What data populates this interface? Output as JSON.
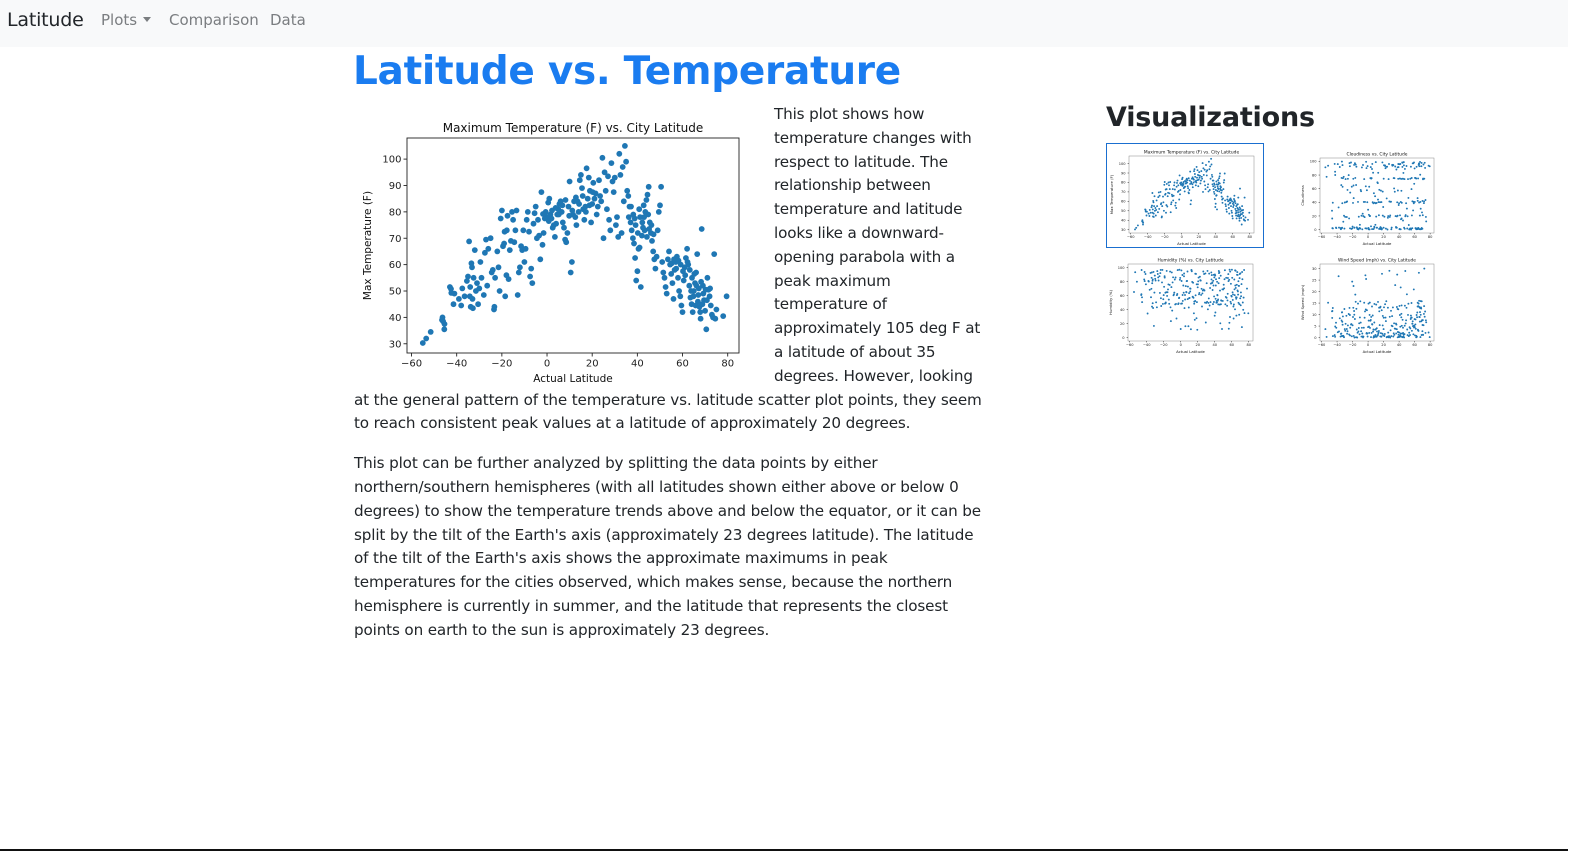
{
  "navbar": {
    "brand": "Latitude",
    "links": [
      {
        "label": "Plots",
        "dropdown": true
      },
      {
        "label": "Comparison"
      },
      {
        "label": "Data"
      }
    ]
  },
  "main": {
    "title": "Latitude vs. Temperature",
    "paragraphs": [
      "This plot shows how temperature changes with respect to latitude. The relationship between temperature and latitude looks like a downward-opening parabola with a peak maximum temperature of approximately 105 deg F at a latitude of about 35 degrees. However, looking at the general pattern of the temperature vs. latitude scatter plot points, they seem to reach consistent peak values at a latitude of approximately 20 degrees.",
      "This plot can be further analyzed by splitting the data points by either northern/southern hemispheres (with all latitudes shown either above or below 0 degrees) to show the temperature trends above and below the equator, or it can be split by the tilt of the Earth's axis (approximately 23 degrees latitude). The latitude of the tilt of the Earth's axis shows the approximate maximums in peak temperatures for the cities observed, which makes sense, because the northern hemisphere is currently in summer, and the latitude that represents the closest points on earth to the sun is approximately 23 degrees."
    ]
  },
  "sidebar": {
    "title": "Visualizations",
    "thumbnails": [
      {
        "title": "Maximum Temperature (F) vs. City Latitude",
        "selected": true
      },
      {
        "title": "Cloudiness vs. City Latitude",
        "selected": false
      },
      {
        "title": "Humidity (%) vs. City Latitude",
        "selected": false
      },
      {
        "title": "Wind Speed (mph) vs. City Latitude",
        "selected": false
      }
    ]
  },
  "colors": {
    "accent": "#1a7cf0",
    "marker": "#1f77b4",
    "navbar_bg": "#f8f9fa",
    "thumb_selected_border": "#1a6fd0"
  },
  "chart_data": [
    {
      "type": "scatter",
      "title": "Maximum Temperature (F) vs. City Latitude",
      "xlabel": "Actual Latitude",
      "ylabel": "Max Temperature (F)",
      "xlim": [
        -62,
        85
      ],
      "ylim": [
        26.5,
        108
      ],
      "xticks": [
        -60,
        -40,
        -20,
        0,
        20,
        40,
        60,
        80
      ],
      "yticks": [
        30,
        40,
        50,
        60,
        70,
        80,
        90,
        100
      ],
      "grid": false,
      "legend": "none",
      "points": [
        [
          -55,
          30.3
        ],
        [
          -53.5,
          32
        ],
        [
          -51.5,
          34.5
        ],
        [
          -46.5,
          39
        ],
        [
          -46.3,
          40
        ],
        [
          -46,
          38.5
        ],
        [
          -45.5,
          35.5
        ],
        [
          -45.4,
          37.5
        ],
        [
          -43,
          51.5
        ],
        [
          -42.5,
          50.8
        ],
        [
          -42.4,
          49.3
        ],
        [
          -41.4,
          45
        ],
        [
          -41,
          49
        ],
        [
          -39,
          47
        ],
        [
          -38,
          44.5
        ],
        [
          -37.5,
          51
        ],
        [
          -36.5,
          48
        ],
        [
          -35.5,
          53.8
        ],
        [
          -35,
          55.5
        ],
        [
          -34.5,
          68.8
        ],
        [
          -34.2,
          48
        ],
        [
          -34,
          51.5
        ],
        [
          -33.8,
          44
        ],
        [
          -33.5,
          60.5
        ],
        [
          -33.2,
          59
        ],
        [
          -33,
          47
        ],
        [
          -32.8,
          43.5
        ],
        [
          -32.5,
          55
        ],
        [
          -32,
          65.5
        ],
        [
          -31.5,
          50
        ],
        [
          -31,
          53
        ],
        [
          -30.5,
          45
        ],
        [
          -30,
          51
        ],
        [
          -29.5,
          61
        ],
        [
          -29,
          55
        ],
        [
          -28,
          48.5
        ],
        [
          -27.5,
          64.5
        ],
        [
          -27,
          69.5
        ],
        [
          -26.5,
          52
        ],
        [
          -26,
          66
        ],
        [
          -25,
          70
        ],
        [
          -24.5,
          57
        ],
        [
          -24,
          58
        ],
        [
          -23.5,
          43
        ],
        [
          -23.3,
          44
        ],
        [
          -23,
          55
        ],
        [
          -22,
          65
        ],
        [
          -21.5,
          59
        ],
        [
          -21,
          50
        ],
        [
          -20.5,
          77.5
        ],
        [
          -20,
          80.5
        ],
        [
          -19.5,
          67
        ],
        [
          -19,
          68
        ],
        [
          -18.8,
          72.5
        ],
        [
          -18.5,
          48
        ],
        [
          -18,
          56
        ],
        [
          -17.8,
          73
        ],
        [
          -17.5,
          78.5
        ],
        [
          -17,
          54.5
        ],
        [
          -16.5,
          65.5
        ],
        [
          -16,
          69
        ],
        [
          -15.5,
          80
        ],
        [
          -15,
          77
        ],
        [
          -14.5,
          68.5
        ],
        [
          -14,
          73
        ],
        [
          -13.5,
          80.5
        ],
        [
          -13,
          48.5
        ],
        [
          -12.5,
          57
        ],
        [
          -12,
          59
        ],
        [
          -11.5,
          67
        ],
        [
          -11,
          65.5
        ],
        [
          -10.5,
          73
        ],
        [
          -10,
          61
        ],
        [
          -9.5,
          66
        ],
        [
          -9,
          77
        ],
        [
          -8.5,
          80
        ],
        [
          -8,
          72.5
        ],
        [
          -7.5,
          55.5
        ],
        [
          -7,
          58.5
        ],
        [
          -6.5,
          53
        ],
        [
          -6,
          75.5
        ],
        [
          -5.5,
          79.5
        ],
        [
          -5,
          82
        ],
        [
          -4.5,
          70
        ],
        [
          -4,
          77
        ],
        [
          -3.5,
          71
        ],
        [
          -3,
          62
        ],
        [
          -2.5,
          87.5
        ],
        [
          -2,
          67.5
        ],
        [
          -1.5,
          72
        ],
        [
          -1,
          77.5
        ],
        [
          0,
          78
        ],
        [
          0.5,
          83.5
        ],
        [
          1,
          85
        ],
        [
          1.5,
          79
        ],
        [
          2,
          77.5
        ],
        [
          2.5,
          74
        ],
        [
          3,
          75
        ],
        [
          3.5,
          70.5
        ],
        [
          4,
          75.5
        ],
        [
          4.5,
          79
        ],
        [
          5,
          81
        ],
        [
          5.5,
          83
        ],
        [
          6,
          84
        ],
        [
          6.5,
          80
        ],
        [
          7,
          76
        ],
        [
          7.5,
          74
        ],
        [
          8,
          69.5
        ],
        [
          8.5,
          68.5
        ],
        [
          9,
          72
        ],
        [
          9.5,
          82
        ],
        [
          10,
          91.5
        ],
        [
          10.5,
          57
        ],
        [
          11,
          61
        ],
        [
          11.5,
          79
        ],
        [
          12,
          84
        ],
        [
          12.5,
          78
        ],
        [
          13,
          75
        ],
        [
          13.5,
          84
        ],
        [
          14,
          80
        ],
        [
          14.5,
          92
        ],
        [
          15,
          94
        ],
        [
          15.5,
          89
        ],
        [
          16,
          81
        ],
        [
          16.5,
          77
        ],
        [
          17,
          82
        ],
        [
          17.5,
          96.5
        ],
        [
          18,
          85
        ],
        [
          18.5,
          93
        ],
        [
          19,
          88
        ],
        [
          19.5,
          76
        ],
        [
          20,
          83
        ],
        [
          20.5,
          91
        ],
        [
          21,
          85
        ],
        [
          21.5,
          87
        ],
        [
          22,
          79
        ],
        [
          22.5,
          82
        ],
        [
          23,
          92
        ],
        [
          23.5,
          86
        ],
        [
          24,
          84
        ],
        [
          24.5,
          100.5
        ],
        [
          25,
          70
        ],
        [
          25.5,
          95
        ],
        [
          26,
          88
        ],
        [
          26.5,
          81
        ],
        [
          27,
          93.5
        ],
        [
          27.5,
          77
        ],
        [
          28,
          73
        ],
        [
          28.5,
          98.5
        ],
        [
          29,
          91.5
        ],
        [
          29.5,
          87.5
        ],
        [
          30,
          93
        ],
        [
          30.5,
          75
        ],
        [
          31,
          78
        ],
        [
          31.5,
          70.5
        ],
        [
          32,
          102
        ],
        [
          32.5,
          94
        ],
        [
          33,
          72
        ],
        [
          33.5,
          97
        ],
        [
          34,
          84
        ],
        [
          34.5,
          105
        ],
        [
          35,
          99
        ],
        [
          35.5,
          88
        ],
        [
          36,
          86
        ],
        [
          36.5,
          82
        ],
        [
          37,
          76
        ],
        [
          37.5,
          73
        ],
        [
          38,
          70
        ],
        [
          38.5,
          68
        ],
        [
          39,
          62.5
        ],
        [
          39.5,
          54
        ],
        [
          40,
          57.5
        ],
        [
          40.5,
          66
        ],
        [
          41,
          66.5
        ],
        [
          41.5,
          51.5
        ],
        [
          42,
          71
        ],
        [
          42.5,
          74
        ],
        [
          43,
          78
        ],
        [
          43.5,
          80
        ],
        [
          44,
          84.5
        ],
        [
          44.5,
          86.5
        ],
        [
          45,
          89.5
        ],
        [
          45.5,
          76
        ],
        [
          46,
          72
        ],
        [
          46.5,
          69
        ],
        [
          47,
          65
        ],
        [
          47.5,
          62
        ],
        [
          48,
          58.5
        ],
        [
          48.5,
          63
        ],
        [
          49,
          73
        ],
        [
          49.5,
          80
        ],
        [
          50,
          82.5
        ],
        [
          50.5,
          89.5
        ],
        [
          51,
          61
        ],
        [
          51.5,
          57
        ],
        [
          52,
          55
        ],
        [
          52.5,
          51.5
        ],
        [
          53,
          49
        ],
        [
          53.5,
          62
        ],
        [
          54,
          65
        ],
        [
          54.5,
          60
        ],
        [
          55,
          56.5
        ],
        [
          55.5,
          53
        ],
        [
          56,
          47
        ],
        [
          56.5,
          58
        ],
        [
          57,
          61
        ],
        [
          57.5,
          63
        ],
        [
          58,
          55
        ],
        [
          58.5,
          50
        ],
        [
          59,
          48
        ],
        [
          59.5,
          44.5
        ],
        [
          60,
          42
        ],
        [
          60.5,
          54
        ],
        [
          61,
          59
        ],
        [
          61.5,
          62.5
        ],
        [
          62,
          66
        ],
        [
          62.5,
          60
        ],
        [
          63,
          52
        ],
        [
          63.5,
          47.5
        ],
        [
          64,
          45
        ],
        [
          64.5,
          42
        ],
        [
          65,
          50
        ],
        [
          65.5,
          53
        ],
        [
          66,
          57
        ],
        [
          66.5,
          64
        ],
        [
          67,
          48.5
        ],
        [
          67.5,
          44
        ],
        [
          68,
          39.5
        ],
        [
          68.5,
          73.5
        ],
        [
          69,
          52
        ],
        [
          69.5,
          46.5
        ],
        [
          70,
          42.5
        ],
        [
          70.5,
          35.5
        ],
        [
          71,
          55
        ],
        [
          71.5,
          50.5
        ],
        [
          72,
          48
        ],
        [
          72.5,
          44.5
        ],
        [
          73,
          41
        ],
        [
          73.5,
          40
        ],
        [
          74,
          64
        ],
        [
          74.5,
          39.5
        ],
        [
          75,
          43
        ],
        [
          78,
          40.5
        ],
        [
          79.5,
          48
        ],
        [
          -1.8,
          79.2
        ],
        [
          -0.6,
          80
        ],
        [
          0.8,
          76.5
        ],
        [
          2.2,
          80.5
        ],
        [
          3.8,
          81.5
        ],
        [
          5.2,
          79
        ],
        [
          6.8,
          82.5
        ],
        [
          8.2,
          84.5
        ],
        [
          9.8,
          78.5
        ],
        [
          11.2,
          80.5
        ],
        [
          12.8,
          85.5
        ],
        [
          14.2,
          83
        ],
        [
          15.8,
          86
        ],
        [
          17.2,
          80
        ],
        [
          18.8,
          82.5
        ],
        [
          20.2,
          87.5
        ],
        [
          36.2,
          78
        ],
        [
          37.2,
          82
        ],
        [
          38.2,
          79
        ],
        [
          39.2,
          75
        ],
        [
          40.2,
          72
        ],
        [
          41.2,
          78
        ],
        [
          42.2,
          76
        ],
        [
          43.2,
          73
        ],
        [
          44.2,
          70.5
        ],
        [
          45.2,
          73.5
        ],
        [
          46.2,
          75
        ],
        [
          47.2,
          71.5
        ],
        [
          38.8,
          77.5
        ],
        [
          40.8,
          81
        ],
        [
          42.8,
          82.5
        ],
        [
          44.8,
          79
        ],
        [
          55.2,
          60.5
        ],
        [
          56.2,
          62
        ],
        [
          57.2,
          58.5
        ],
        [
          58.2,
          61.5
        ],
        [
          59.2,
          60
        ],
        [
          60.2,
          57.5
        ],
        [
          61.2,
          56
        ],
        [
          62.2,
          61
        ],
        [
          63.2,
          58
        ],
        [
          64.2,
          55
        ],
        [
          65.2,
          56.5
        ],
        [
          66.2,
          52
        ],
        [
          67.2,
          51
        ],
        [
          68.2,
          53.5
        ],
        [
          69.2,
          49
        ],
        [
          70.2,
          50.5
        ],
        [
          64.8,
          48
        ],
        [
          66.8,
          46
        ],
        [
          68.8,
          45
        ],
        [
          70.8,
          46.5
        ],
        [
          72.2,
          51
        ],
        [
          63.8,
          50
        ],
        [
          65.8,
          44.5
        ],
        [
          67.8,
          42
        ]
      ]
    },
    {
      "type": "scatter",
      "title": "Maximum Temperature (F) vs. City Latitude",
      "xlabel": "Actual Latitude",
      "ylabel": "Max Temperature (F)",
      "xlim": [
        -62,
        85
      ],
      "ylim": [
        26.5,
        108
      ],
      "xticks": [
        -60,
        -40,
        -20,
        0,
        20,
        40,
        60,
        80
      ],
      "yticks": [
        30,
        40,
        50,
        60,
        70,
        80,
        90,
        100
      ],
      "reuse_points_of": 0
    },
    {
      "type": "scatter",
      "title": "Cloudiness vs. City Latitude",
      "xlabel": "Actual Latitude",
      "ylabel": "Cloudiness",
      "xlim": [
        -62,
        85
      ],
      "ylim": [
        -5,
        105
      ],
      "xticks": [
        -60,
        -40,
        -20,
        0,
        20,
        40,
        60,
        80
      ],
      "yticks": [
        0,
        20,
        40,
        60,
        80,
        100
      ],
      "points_generated": "banded",
      "bands": [
        0,
        20,
        40,
        75,
        90,
        100
      ]
    },
    {
      "type": "scatter",
      "title": "Humidity (%) vs. City Latitude",
      "xlabel": "Actual Latitude",
      "ylabel": "Humidity (%)",
      "xlim": [
        -62,
        85
      ],
      "ylim": [
        -5,
        105
      ],
      "xticks": [
        -60,
        -40,
        -20,
        0,
        20,
        40,
        60,
        80
      ],
      "yticks": [
        0,
        20,
        40,
        60,
        80,
        100
      ],
      "points_generated": "humidity"
    },
    {
      "type": "scatter",
      "title": "Wind Speed (mph) vs. City Latitude",
      "xlabel": "Actual Latitude",
      "ylabel": "Wind Speed (mph)",
      "xlim": [
        -62,
        85
      ],
      "ylim": [
        -1.5,
        32
      ],
      "xticks": [
        -60,
        -40,
        -20,
        0,
        20,
        40,
        60,
        80
      ],
      "yticks": [
        0,
        5,
        10,
        15,
        20,
        25,
        30
      ],
      "points_generated": "wind"
    }
  ]
}
